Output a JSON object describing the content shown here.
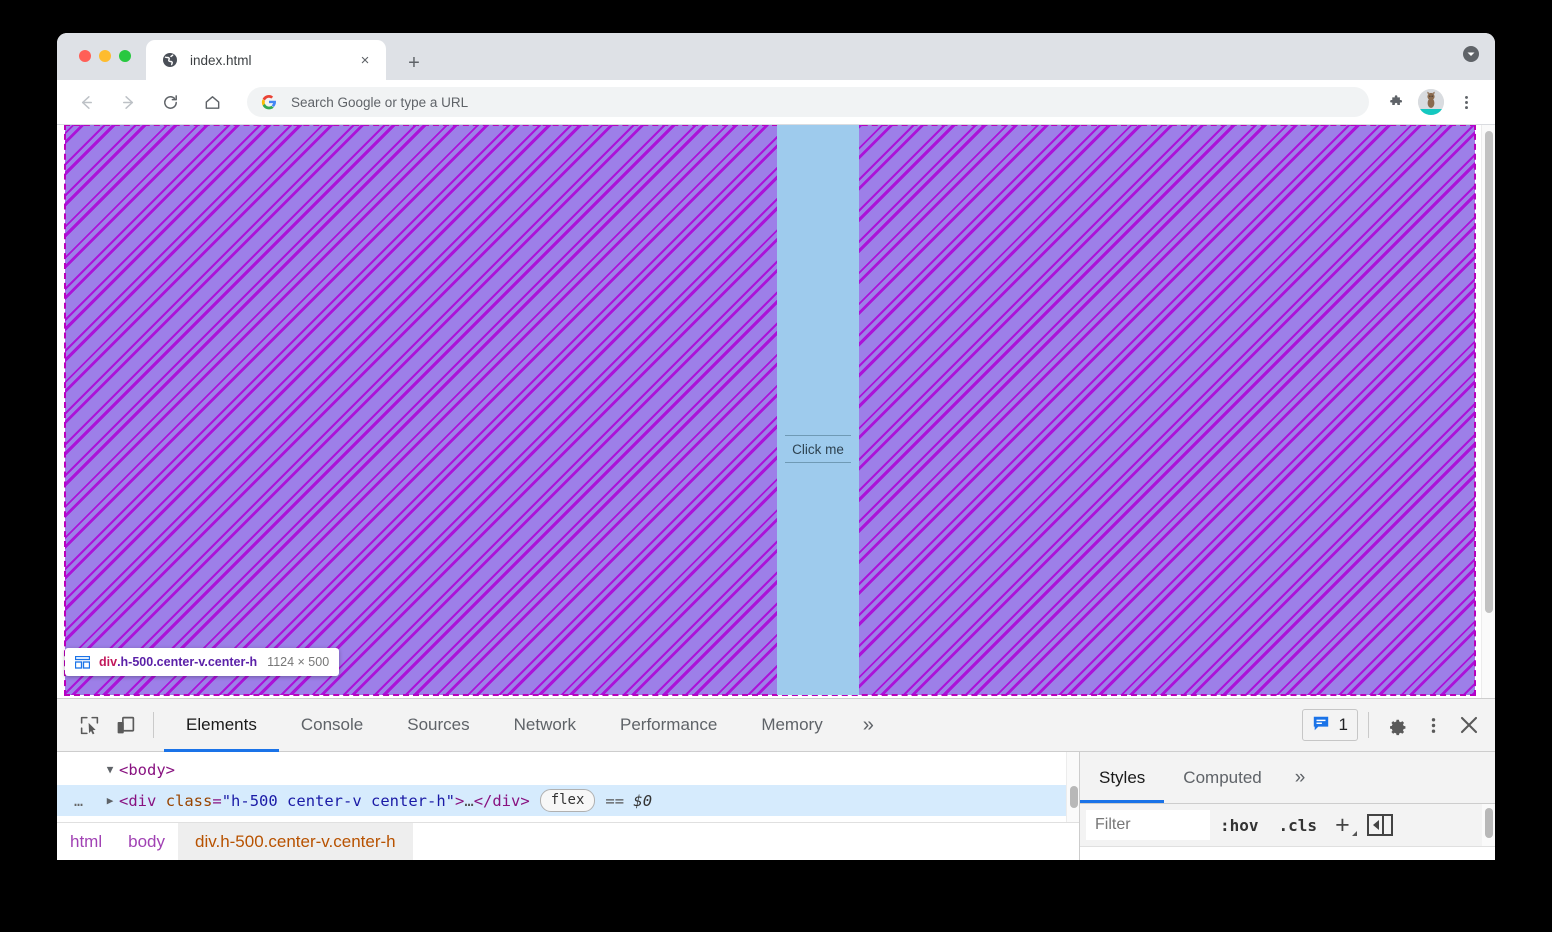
{
  "browser": {
    "tab": {
      "title": "index.html",
      "favicon": "globe-icon",
      "close_label": "×"
    },
    "new_tab_label": "+",
    "nav": {
      "back_label": "←",
      "forward_label": "→",
      "reload_label": "⟳",
      "home_label": "⌂"
    },
    "omnibox": {
      "placeholder": "Search Google or type a URL",
      "value": "Search Google or type a URL",
      "icon": "google-g-icon"
    },
    "toolbar_right": {
      "extensions": "puzzle-icon",
      "profile": "avatar-cat",
      "menu": "three-dot-menu-icon"
    }
  },
  "viewport": {
    "highlight_tooltip": {
      "icon": "flex-grid-icon",
      "tag": "div",
      "classes": ".h-500.center-v.center-h",
      "dimensions": "1124 × 500"
    },
    "button": {
      "label": "Click me"
    },
    "overlay": {
      "container_color": "#9d7fe8",
      "hatch_color": "#ad00d6",
      "dash_color": "#bb00bb",
      "item_color": "#9ecbed"
    }
  },
  "devtools": {
    "toolbar": {
      "inspect_icon": "inspect-cursor-icon",
      "device_icon": "device-toolbar-icon",
      "tabs": [
        {
          "label": "Elements",
          "active": true
        },
        {
          "label": "Console",
          "active": false
        },
        {
          "label": "Sources",
          "active": false
        },
        {
          "label": "Network",
          "active": false
        },
        {
          "label": "Performance",
          "active": false
        },
        {
          "label": "Memory",
          "active": false
        }
      ],
      "more_label": "»",
      "message_badge": {
        "icon": "console-message-icon",
        "count": "1"
      },
      "settings_icon": "gear-icon",
      "kebab_icon": "three-dot-menu-icon",
      "close_icon": "close-icon"
    },
    "dom": {
      "rows": [
        {
          "indent": 0,
          "arrow": "▼",
          "dots": "",
          "open_bracket": "<",
          "tag": "body",
          "close_bracket": ">",
          "selected": false
        }
      ],
      "selected_row": {
        "dots": "…",
        "arrow": "▶",
        "open": "<",
        "tag": "div",
        "attr_name": "class",
        "attr_eq": "=",
        "attr_value": "\"h-500 center-v center-h\"",
        "gt": ">",
        "ellipsis": "…",
        "close_tag": "</div>",
        "badge": "flex",
        "equals": "==",
        "selector": "$0"
      }
    },
    "breadcrumb": [
      {
        "label": "html",
        "active": false
      },
      {
        "label": "body",
        "active": false
      },
      {
        "label": "div.h-500.center-v.center-h",
        "active": true
      }
    ],
    "styles": {
      "tabs": [
        {
          "label": "Styles",
          "active": true
        },
        {
          "label": "Computed",
          "active": false
        }
      ],
      "more_label": "»",
      "filter_placeholder": "Filter",
      "hov_label": ":hov",
      "cls_label": ".cls",
      "new_rule_label": "+",
      "dock_icon": "dock-to-left-icon"
    }
  }
}
